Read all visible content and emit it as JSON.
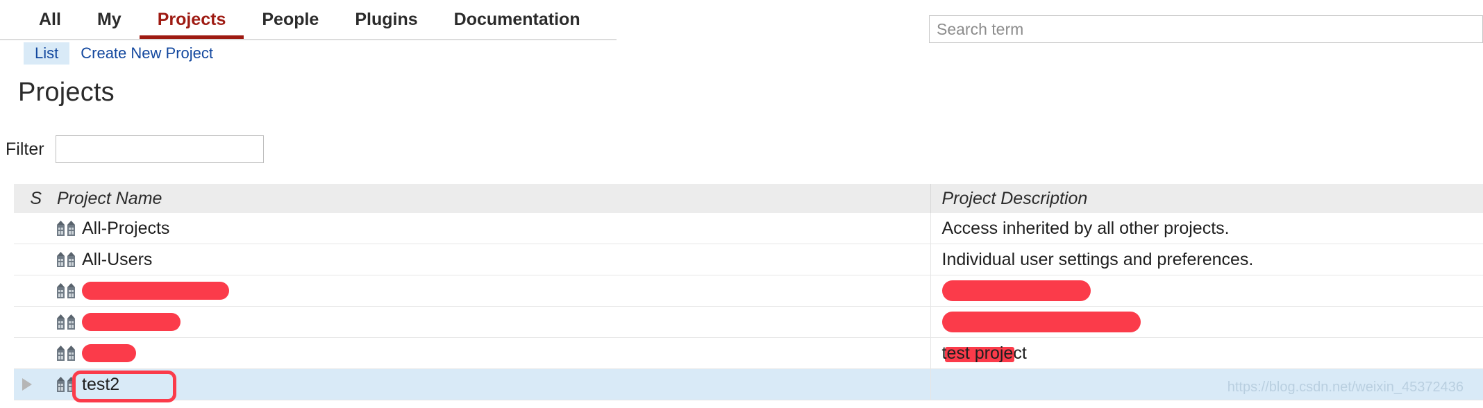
{
  "nav": {
    "tabs": [
      {
        "label": "All",
        "active": false
      },
      {
        "label": "My",
        "active": false
      },
      {
        "label": "Projects",
        "active": true
      },
      {
        "label": "People",
        "active": false
      },
      {
        "label": "Plugins",
        "active": false
      },
      {
        "label": "Documentation",
        "active": false
      }
    ],
    "sub_tabs": [
      {
        "label": "List",
        "active": true
      },
      {
        "label": "Create New Project",
        "active": false
      }
    ]
  },
  "search": {
    "placeholder": "Search term",
    "value": ""
  },
  "page": {
    "title": "Projects"
  },
  "filter": {
    "label": "Filter",
    "value": "",
    "placeholder": ""
  },
  "table": {
    "headers": {
      "status": "S",
      "name": "Project Name",
      "description": "Project Description"
    },
    "rows": [
      {
        "icon": "project-icon",
        "name": "All-Projects",
        "name_redacted": false,
        "description": "Access inherited by all other projects.",
        "description_redacted": false,
        "selected": false,
        "expandable": false
      },
      {
        "icon": "project-icon",
        "name": "All-Users",
        "name_redacted": false,
        "description": "Individual user settings and preferences.",
        "description_redacted": false,
        "selected": false,
        "expandable": false
      },
      {
        "icon": "project-icon",
        "name": "",
        "name_redacted": true,
        "name_redact_width": 212,
        "description": "",
        "description_redacted": true,
        "description_redact_width": 214,
        "selected": false,
        "expandable": false
      },
      {
        "icon": "project-icon",
        "name": "",
        "name_redacted": true,
        "name_redact_width": 142,
        "description": "",
        "description_redacted": true,
        "description_redact_width": 286,
        "selected": false,
        "expandable": false
      },
      {
        "icon": "project-icon",
        "name": "",
        "name_redacted": true,
        "name_redact_width": 78,
        "description": "test project",
        "description_redacted": "strike",
        "description_redact_width": 100,
        "selected": false,
        "expandable": false
      },
      {
        "icon": "project-icon",
        "name": "test2",
        "name_redacted": false,
        "description": "",
        "description_redacted": false,
        "selected": true,
        "expandable": true,
        "highlighted": true
      }
    ]
  },
  "watermark": {
    "text": "https://blog.csdn.net/weixin_45372436"
  },
  "colors": {
    "active_tab": "#9e1a12",
    "link": "#12479e",
    "selected_row": "#d9eaf7",
    "redaction": "#fb3b4a",
    "header_bg": "#ececec"
  }
}
